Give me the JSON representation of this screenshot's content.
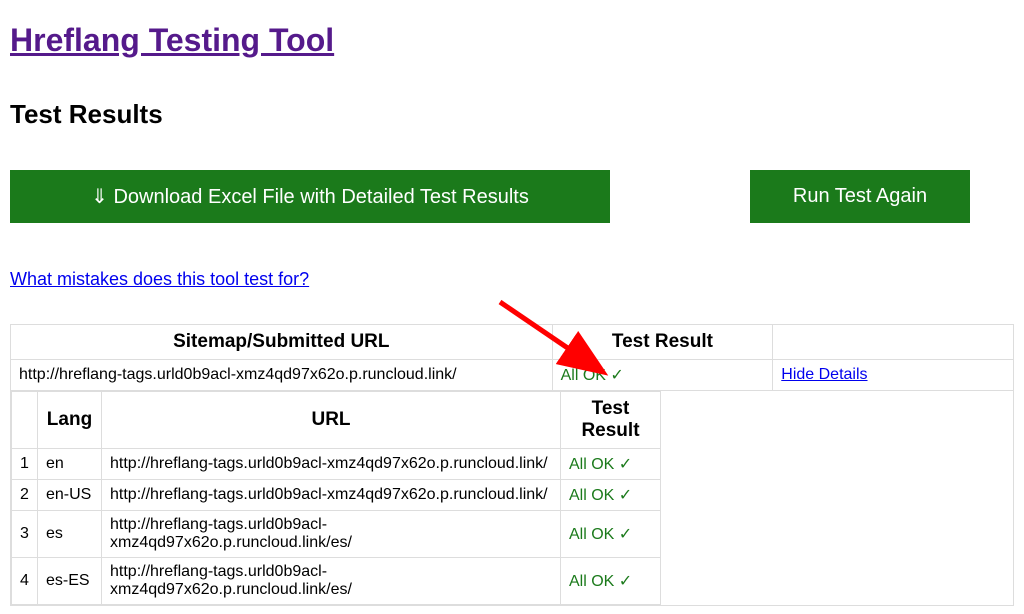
{
  "page_title_link": "Hreflang Testing Tool",
  "subheading": "Test Results",
  "buttons": {
    "download_label": "⇓ Download Excel File with Detailed Test Results",
    "run_again_label": "Run Test Again"
  },
  "help_link_label": "What mistakes does this tool test for?",
  "outer_table": {
    "headers": {
      "url": "Sitemap/Submitted URL",
      "result": "Test Result",
      "details": ""
    },
    "row": {
      "url": "http://hreflang-tags.urld0b9acl-xmz4qd97x62o.p.runcloud.link/",
      "result_text": "All OK",
      "result_check": "✓",
      "details_link": "Hide Details"
    }
  },
  "inner_table": {
    "headers": {
      "num": "",
      "lang": "Lang",
      "url": "URL",
      "result": "Test Result"
    },
    "rows": [
      {
        "num": "1",
        "lang": "en",
        "url": "http://hreflang-tags.urld0b9acl-xmz4qd97x62o.p.runcloud.link/",
        "result_text": "All OK",
        "result_check": "✓"
      },
      {
        "num": "2",
        "lang": "en-US",
        "url": "http://hreflang-tags.urld0b9acl-xmz4qd97x62o.p.runcloud.link/",
        "result_text": "All OK",
        "result_check": "✓"
      },
      {
        "num": "3",
        "lang": "es",
        "url": "http://hreflang-tags.urld0b9acl-xmz4qd97x62o.p.runcloud.link/es/",
        "result_text": "All OK",
        "result_check": "✓"
      },
      {
        "num": "4",
        "lang": "es-ES",
        "url": "http://hreflang-tags.urld0b9acl-xmz4qd97x62o.p.runcloud.link/es/",
        "result_text": "All OK",
        "result_check": "✓"
      }
    ]
  },
  "colors": {
    "accent_green": "#1b7a1b",
    "link_blue": "#0000EE",
    "visited_purple": "#551A8B",
    "arrow_red": "#FF0000"
  }
}
